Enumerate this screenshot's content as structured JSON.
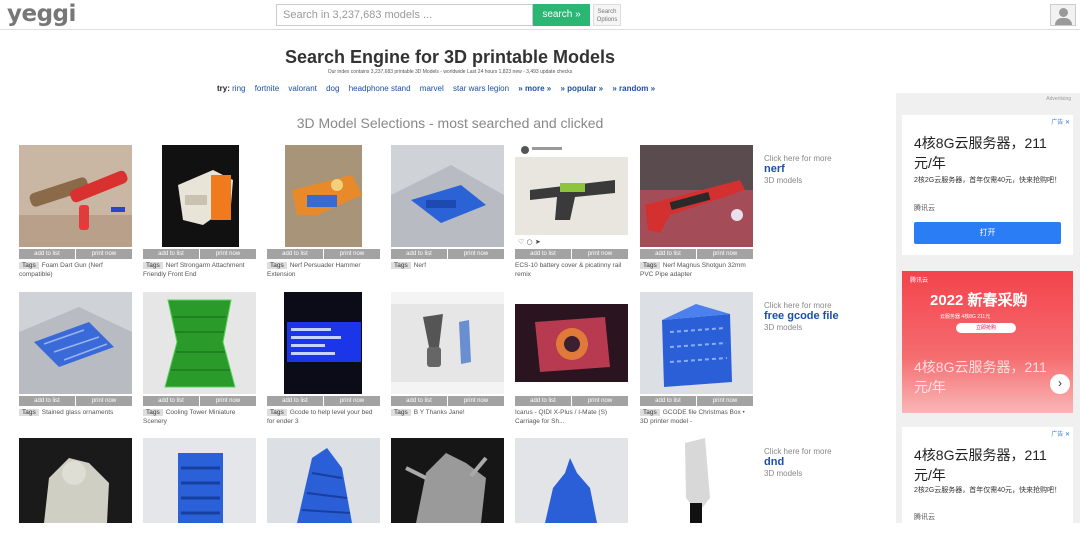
{
  "header": {
    "logo": "yeggi",
    "search_placeholder": "Search in 3,237,683 models ...",
    "search_button": "search »",
    "search_options": "Search Options"
  },
  "hero": {
    "title": "Search Engine for 3D printable Models",
    "subtitle": "Our index contains 3,237,683 printable 3D Models - worldwide     Last 24 hours 1,823 new - 3,493 update checks",
    "try_label": "try:",
    "try_links": [
      "ring",
      "fortnite",
      "valorant",
      "dog",
      "headphone stand",
      "marvel",
      "star wars legion"
    ],
    "more_links": [
      "» more »",
      "» popular »",
      "» random »"
    ]
  },
  "section_title": "3D Model Selections - most searched and clicked",
  "buttons": {
    "add": "add to list",
    "print": "print now"
  },
  "tag_label": "Tags",
  "rows": [
    {
      "items": [
        {
          "caption": "Foam Dart Gun (Nerf compatible)",
          "tagged": true,
          "icon": "foam-dart-gun"
        },
        {
          "caption": "Nerf Strongarm Attachment Friendly Front End",
          "tagged": true,
          "icon": "nerf-strongarm"
        },
        {
          "caption": "Nerf Persuader Hammer Extension",
          "tagged": true,
          "icon": "nerf-persuader"
        },
        {
          "caption": "Nerf",
          "tagged": true,
          "icon": "blue-print"
        },
        {
          "caption": "ECS-10 battery cover & picatinny rail remix",
          "tagged": false,
          "icon": "instagram-gun"
        },
        {
          "caption": "Nerf Magnus Shotgun 32mm PVC Pipe adapter",
          "tagged": true,
          "icon": "shotgun"
        }
      ],
      "more": {
        "line1": "Click here for more",
        "keyword": "nerf",
        "line3": "3D models"
      }
    },
    {
      "items": [
        {
          "caption": "Stained glass ornaments",
          "tagged": true,
          "icon": "stained-glass"
        },
        {
          "caption": "Cooling Tower Miniature Scenery",
          "tagged": true,
          "icon": "cooling-tower"
        },
        {
          "caption": "Gcode to help level your bed for ender 3",
          "tagged": true,
          "icon": "lcd-screen"
        },
        {
          "caption": "B Y Thanks Jane!",
          "tagged": true,
          "icon": "pegs"
        },
        {
          "caption": "Icarus - QIDI X-Plus / I-Mate (S) Carriage for Sh...",
          "tagged": false,
          "icon": "carriage"
        },
        {
          "caption": "GCODE file Christmas Box • 3D printer model  -",
          "tagged": true,
          "icon": "blue-box"
        }
      ],
      "more": {
        "line1": "Click here for more",
        "keyword": "free gcode file",
        "line3": "3D models"
      }
    },
    {
      "items": [
        {
          "icon": "white-figure"
        },
        {
          "icon": "blue-shelf"
        },
        {
          "icon": "blue-tower"
        },
        {
          "icon": "grey-creature"
        },
        {
          "icon": "blue-bust"
        },
        {
          "icon": "white-sword"
        }
      ],
      "more": {
        "line1": "Click here for more",
        "keyword": "dnd",
        "line3": "3D models"
      }
    }
  ],
  "ads": {
    "label": "Advertising",
    "ad1": {
      "headline": "4核8G云服务器，211元/年",
      "body": "2核2G云服务器，首年仅需40元，快来抢购吧！",
      "brand": "腾讯云",
      "button": "打开",
      "badge": "广告 ✕"
    },
    "ad2": {
      "logo": "腾讯云",
      "headline": "2022 新春采购",
      "line": "云服务器 4核8G 211元",
      "button": "立即抢购",
      "overlay": "4核8G云服务器，211元/年",
      "nav": "›"
    },
    "ad3": {
      "headline": "4核8G云服务器，211元/年",
      "body": "2核2G云服务器，首年仅需40元，快来抢购吧！",
      "brand": "腾讯云",
      "badge": "广告 ✕"
    }
  }
}
